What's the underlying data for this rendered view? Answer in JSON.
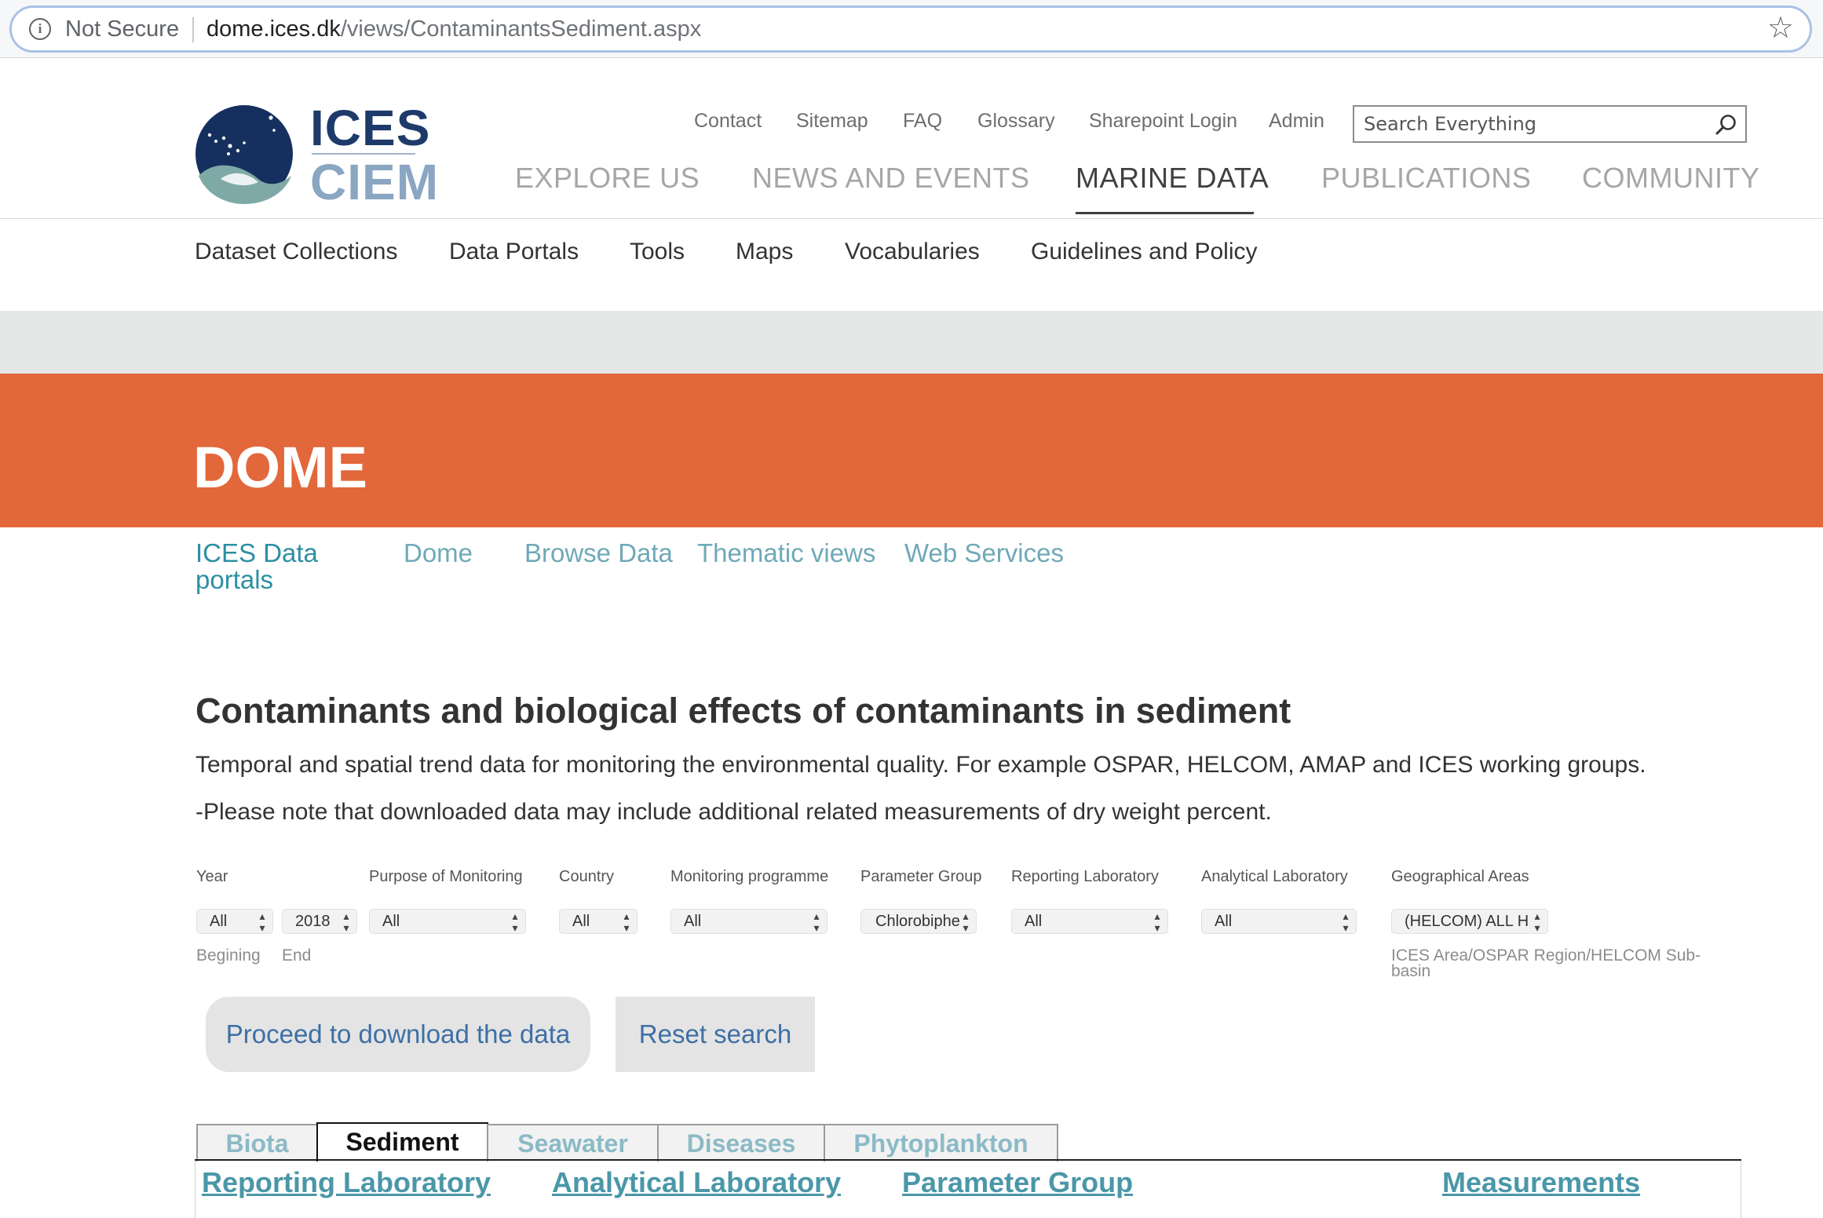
{
  "browser": {
    "security_label": "Not Secure",
    "url_host": "dome.ices.dk",
    "url_path": "/views/ContaminantsSediment.aspx"
  },
  "logo": {
    "top": "ICES",
    "bottom": "CIEM"
  },
  "utility_nav": [
    "Contact",
    "Sitemap",
    "FAQ",
    "Glossary",
    "Sharepoint Login",
    "Admin"
  ],
  "search": {
    "placeholder": "Search Everything"
  },
  "main_nav": {
    "items": [
      "EXPLORE US",
      "NEWS AND EVENTS",
      "MARINE DATA",
      "PUBLICATIONS",
      "COMMUNITY"
    ],
    "active": "MARINE DATA"
  },
  "sub_nav": [
    "Dataset Collections",
    "Data Portals",
    "Tools",
    "Maps",
    "Vocabularies",
    "Guidelines and Policy"
  ],
  "banner": {
    "title": "DOME"
  },
  "portal_nav": [
    "ICES Data portals",
    "Dome",
    "Browse Data",
    "Thematic views",
    "Web Services"
  ],
  "content": {
    "heading": "Contaminants and biological effects of contaminants in sediment",
    "description": "Temporal and spatial trend data for monitoring the environmental quality. For example OSPAR, HELCOM, AMAP and ICES working groups.",
    "note": "-Please note that downloaded data may include additional related measurements of dry weight percent."
  },
  "filters": {
    "labels": [
      "Year",
      "Purpose of Monitoring",
      "Country",
      "Monitoring programme",
      "Parameter Group",
      "Reporting Laboratory",
      "Analytical Laboratory",
      "Geographical Areas"
    ],
    "values": {
      "year_begin": "All",
      "year_end": "2018",
      "purpose": "All",
      "country": "All",
      "programme": "All",
      "parameter_group": "Chlorobiphe",
      "reporting_lab": "All",
      "analytical_lab": "All",
      "geo_area": "(HELCOM) ALL H"
    },
    "hints": {
      "begin": "Begining",
      "end": "End",
      "geo": "ICES Area/OSPAR Region/HELCOM Sub-basin"
    }
  },
  "buttons": {
    "download": "Proceed to download the data",
    "reset": "Reset search"
  },
  "tabs": {
    "items": [
      "Biota",
      "Sediment",
      "Seawater",
      "Diseases",
      "Phytoplankton"
    ],
    "active": "Sediment"
  },
  "table_links": [
    "Reporting Laboratory",
    "Analytical Laboratory",
    "Parameter Group",
    "Measurements"
  ],
  "colors": {
    "banner": "#e2673a",
    "link": "#4a97a8",
    "button_text": "#3d6fa6"
  }
}
